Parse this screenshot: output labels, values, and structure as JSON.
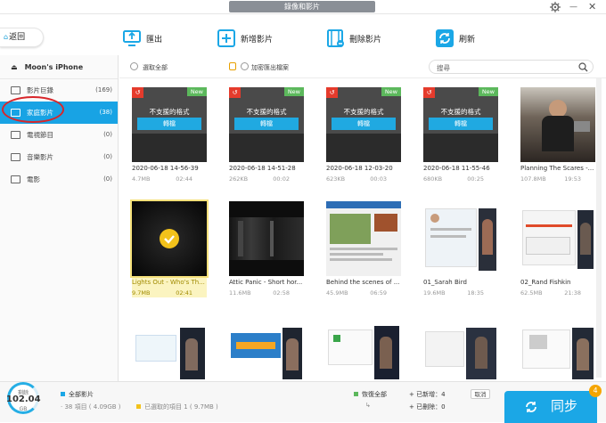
{
  "window": {
    "title": "錄像和影片"
  },
  "header": {
    "back_label": "返回"
  },
  "toolbar": {
    "export_label": "匯出",
    "add_label": "新增影片",
    "delete_label": "刪除影片",
    "refresh_label": "刷新"
  },
  "sidebar": {
    "device_name": "Moon's iPhone",
    "items": [
      {
        "label": "影片巨錄",
        "count": "(169)"
      },
      {
        "label": "家庭影片",
        "count": "(38)"
      },
      {
        "label": "電視節目",
        "count": "(0)"
      },
      {
        "label": "音樂影片",
        "count": "(0)"
      },
      {
        "label": "電影",
        "count": "(0)"
      }
    ]
  },
  "filter": {
    "select_all_label": "選取全部",
    "encrypt_label": "加密匯出檔案",
    "search_placeholder": "搜尋"
  },
  "unsupported": {
    "text": "不支援的格式",
    "convert_label": "轉檔"
  },
  "badges": {
    "new": "New"
  },
  "videos": [
    {
      "name": "2020-06-18 14-56-39",
      "size": "4.7MB",
      "duration": "02:44"
    },
    {
      "name": "2020-06-18 14-51-28",
      "size": "262KB",
      "duration": "00:02"
    },
    {
      "name": "2020-06-18 12-03-20",
      "size": "623KB",
      "duration": "00:03"
    },
    {
      "name": "2020-06-18 11-55-46",
      "size": "680KB",
      "duration": "00:25"
    },
    {
      "name": "Planning The Scares -...",
      "size": "107.8MB",
      "duration": "19:53"
    },
    {
      "name": "Lights Out - Who's Th...",
      "size": "9.7MB",
      "duration": "02:41"
    },
    {
      "name": "Attic Panic - Short hor...",
      "size": "11.6MB",
      "duration": "02:58"
    },
    {
      "name": "Behind the scenes of ...",
      "size": "45.9MB",
      "duration": "06:59"
    },
    {
      "name": "01_Sarah Bird",
      "size": "19.6MB",
      "duration": "18:35"
    },
    {
      "name": "02_Rand Fishkin",
      "size": "62.5MB",
      "duration": "21:38"
    }
  ],
  "footer": {
    "storage_label": "剩餘",
    "storage_value": "102.04",
    "storage_unit": "GB",
    "all_videos_label": "全部影片",
    "items_total": "38 項目 ( 4.09GB )",
    "selected_items": "已選取的項目 1 ( 9.7MB )",
    "restore_all_label": "恢復全部",
    "added_label": "已新增：4",
    "deleted_label": "已刪除：0",
    "cancel_label": "取消",
    "sync_label": "同步",
    "sync_badge": "4"
  },
  "colors": {
    "accent": "#18a3e4",
    "new_badge": "#5cb85c",
    "alert": "#e53b2c",
    "selection": "#fbf4c0"
  }
}
